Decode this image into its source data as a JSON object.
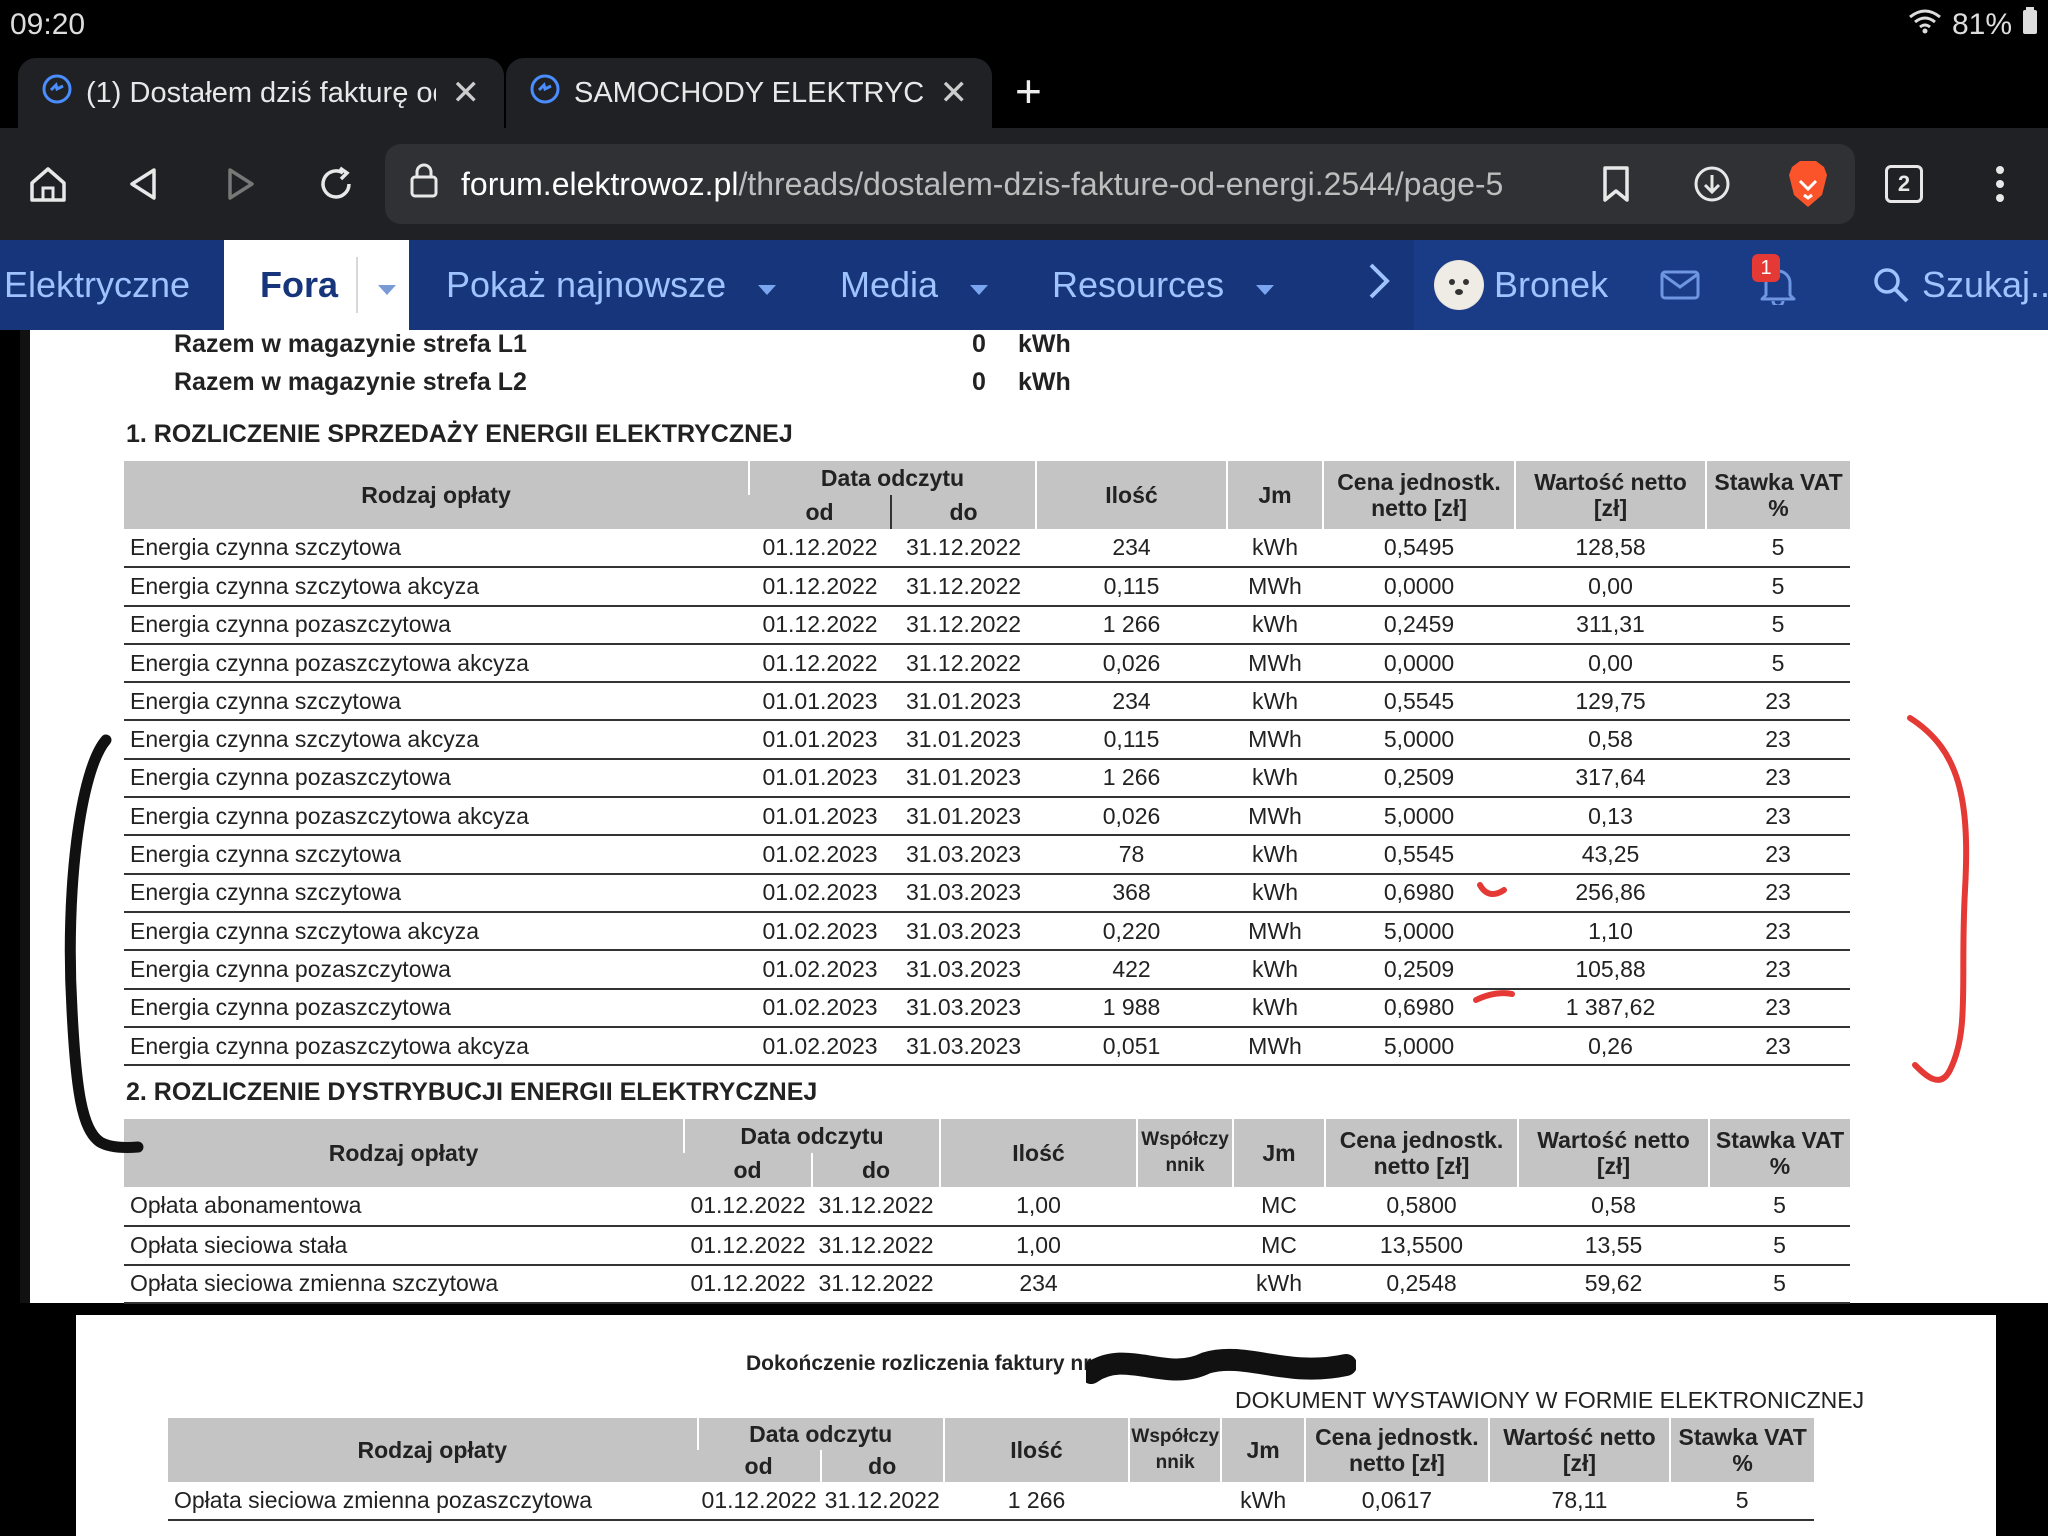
{
  "status": {
    "time": "09:20",
    "battery": "81%"
  },
  "tabs": [
    {
      "title": "(1) Dostałem dziś fakturę od"
    },
    {
      "title": "SAMOCHODY ELEKTRYCZNE"
    }
  ],
  "new_tab": "+",
  "url": {
    "host": "forum.elektrowoz.pl",
    "path": "/threads/dostalem-dzis-fakture-od-energi.2544/page-5"
  },
  "tab_count": "2",
  "nav": {
    "items": [
      "Elektryczne",
      "Fora",
      "Pokaż najnowsze",
      "Media",
      "Resources"
    ],
    "user": "Bronek",
    "alerts_badge": "1",
    "search": "Szukaj.."
  },
  "invoice": {
    "store_rows": [
      {
        "label": "Razem w magazynie strefa L1",
        "value": "0",
        "unit": "kWh"
      },
      {
        "label": "Razem w magazynie strefa L2",
        "value": "0",
        "unit": "kWh"
      }
    ],
    "section1_title": "1. ROZLICZENIE SPRZEDAŻY ENERGII ELEKTRYCZNEJ",
    "section2_title": "2. ROZLICZENIE DYSTRYBUCJI ENERGII ELEKTRYCZNEJ",
    "headers": {
      "rodzaj": "Rodzaj opłaty",
      "data": "Data odczytu",
      "od": "od",
      "do": "do",
      "ilosc": "Ilość",
      "wsp": "Współczy nnik",
      "jm": "Jm",
      "cena": "Cena jednostk. netto [zł]",
      "wartosc": "Wartość netto [zł]",
      "vat": "Stawka VAT %"
    },
    "table1": [
      [
        "Energia czynna szczytowa",
        "01.12.2022",
        "31.12.2022",
        "234",
        "kWh",
        "0,5495",
        "128,58",
        "5"
      ],
      [
        "Energia czynna szczytowa akcyza",
        "01.12.2022",
        "31.12.2022",
        "0,115",
        "MWh",
        "0,0000",
        "0,00",
        "5"
      ],
      [
        "Energia czynna pozaszczytowa",
        "01.12.2022",
        "31.12.2022",
        "1 266",
        "kWh",
        "0,2459",
        "311,31",
        "5"
      ],
      [
        "Energia czynna pozaszczytowa akcyza",
        "01.12.2022",
        "31.12.2022",
        "0,026",
        "MWh",
        "0,0000",
        "0,00",
        "5"
      ],
      [
        "Energia czynna szczytowa",
        "01.01.2023",
        "31.01.2023",
        "234",
        "kWh",
        "0,5545",
        "129,75",
        "23"
      ],
      [
        "Energia czynna szczytowa akcyza",
        "01.01.2023",
        "31.01.2023",
        "0,115",
        "MWh",
        "5,0000",
        "0,58",
        "23"
      ],
      [
        "Energia czynna pozaszczytowa",
        "01.01.2023",
        "31.01.2023",
        "1 266",
        "kWh",
        "0,2509",
        "317,64",
        "23"
      ],
      [
        "Energia czynna pozaszczytowa akcyza",
        "01.01.2023",
        "31.01.2023",
        "0,026",
        "MWh",
        "5,0000",
        "0,13",
        "23"
      ],
      [
        "Energia czynna szczytowa",
        "01.02.2023",
        "31.03.2023",
        "78",
        "kWh",
        "0,5545",
        "43,25",
        "23"
      ],
      [
        "Energia czynna szczytowa",
        "01.02.2023",
        "31.03.2023",
        "368",
        "kWh",
        "0,6980",
        "256,86",
        "23"
      ],
      [
        "Energia czynna szczytowa akcyza",
        "01.02.2023",
        "31.03.2023",
        "0,220",
        "MWh",
        "5,0000",
        "1,10",
        "23"
      ],
      [
        "Energia czynna pozaszczytowa",
        "01.02.2023",
        "31.03.2023",
        "422",
        "kWh",
        "0,2509",
        "105,88",
        "23"
      ],
      [
        "Energia czynna pozaszczytowa",
        "01.02.2023",
        "31.03.2023",
        "1 988",
        "kWh",
        "0,6980",
        "1 387,62",
        "23"
      ],
      [
        "Energia czynna pozaszczytowa akcyza",
        "01.02.2023",
        "31.03.2023",
        "0,051",
        "MWh",
        "5,0000",
        "0,26",
        "23"
      ]
    ],
    "table2": [
      [
        "Opłata abonamentowa",
        "01.12.2022",
        "31.12.2022",
        "1,00",
        "",
        "MC",
        "0,5800",
        "0,58",
        "5"
      ],
      [
        "Opłata sieciowa stała",
        "01.12.2022",
        "31.12.2022",
        "1,00",
        "",
        "MC",
        "13,5500",
        "13,55",
        "5"
      ],
      [
        "Opłata sieciowa zmienna szczytowa",
        "01.12.2022",
        "31.12.2022",
        "234",
        "",
        "kWh",
        "0,2548",
        "59,62",
        "5"
      ]
    ],
    "continuation": "Dokończenie rozliczenia faktury nr",
    "electronic_doc": "DOKUMENT WYSTAWIONY W FORMIE ELEKTRONICZNEJ",
    "table3": [
      [
        "Opłata sieciowa zmienna pozaszczytowa",
        "01.12.2022",
        "31.12.2022",
        "1 266",
        "",
        "kWh",
        "0,0617",
        "78,11",
        "5"
      ]
    ]
  },
  "colors": {
    "nav_bg": "#17357a",
    "nav_text": "#9fc3ff",
    "annotation_red": "#e53935",
    "annotation_black": "#111111"
  }
}
